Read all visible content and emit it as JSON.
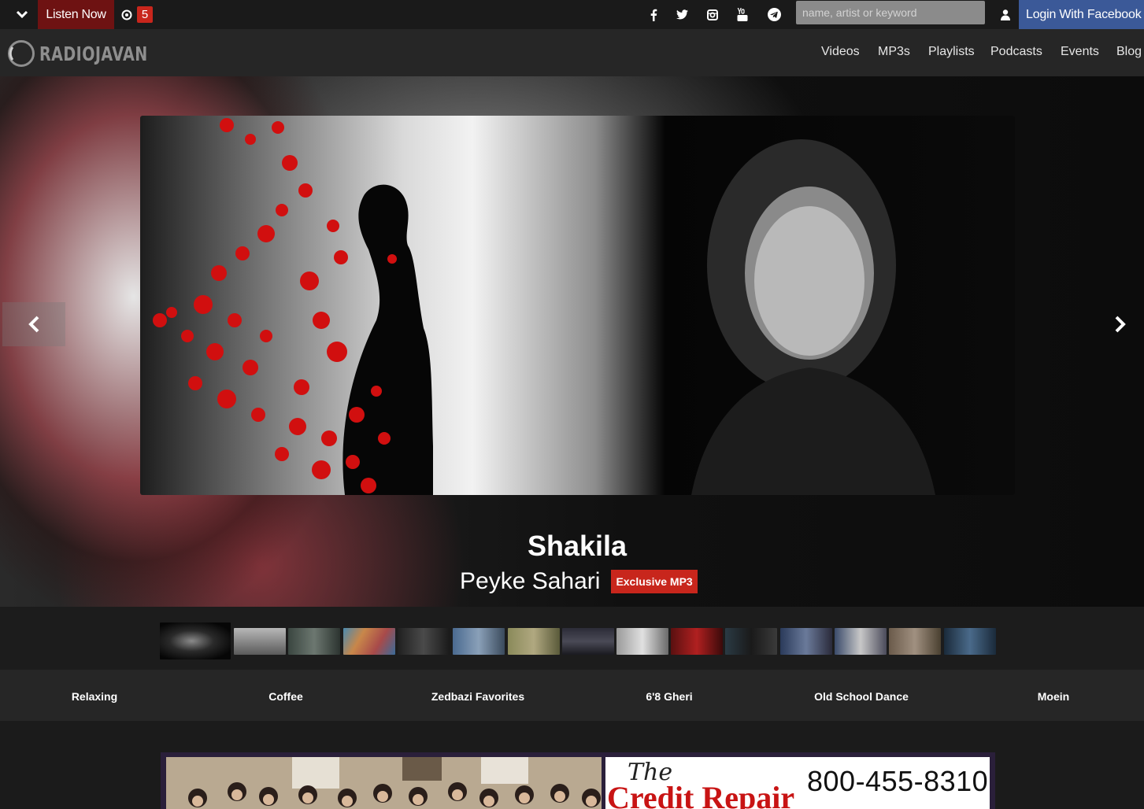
{
  "topbar": {
    "listen_now": "Listen Now",
    "notification_count": "5",
    "search_placeholder": "name, artist or keyword",
    "login_label": "Login With Facebook",
    "social_icons": [
      "facebook-icon",
      "twitter-icon",
      "instagram-icon",
      "youtube-icon",
      "telegram-icon"
    ]
  },
  "header": {
    "logo_text": "RADIOJAVAN",
    "nav": [
      "Videos",
      "MP3s",
      "Playlists",
      "Podcasts",
      "Events",
      "Blog"
    ]
  },
  "hero": {
    "artist": "Shakila",
    "song": "Peyke Sahari",
    "badge": "Exclusive MP3"
  },
  "playlists": [
    "Relaxing",
    "Coffee",
    "Zedbazi Favorites",
    "6'8 Gheri",
    "Old School Dance",
    "Moein"
  ],
  "ad": {
    "brand_the": "The",
    "brand": "Credit Repair",
    "phone": "800-455-8310"
  },
  "colors": {
    "accent_red": "#c8261c",
    "listen_bg": "#6e1212",
    "facebook_blue": "#3b5998"
  }
}
